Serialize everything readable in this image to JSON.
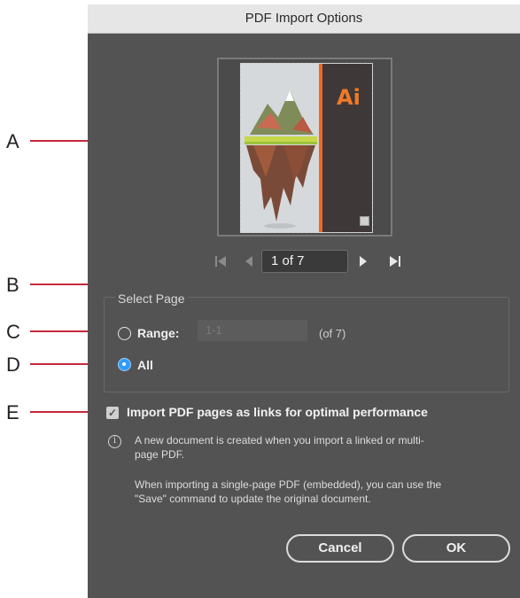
{
  "dialog": {
    "title": "PDF Import Options"
  },
  "preview": {
    "logo_text": "Ai"
  },
  "pagination": {
    "first_icon": "skip-to-first-icon",
    "prev_icon": "previous-icon",
    "next_icon": "next-icon",
    "last_icon": "skip-to-last-icon",
    "page_value": "1 of 7"
  },
  "select_page": {
    "title": "Select Page",
    "range_label": "Range:",
    "range_placeholder": "1-1",
    "range_total": "(of 7)",
    "all_label": "All",
    "selected": "All"
  },
  "import_links": {
    "label": "Import PDF pages as links for optimal performance",
    "checked": true
  },
  "info": {
    "line1": "A new document is created when you import a linked or multi-",
    "line2": "page PDF.",
    "line3": "When importing a single-page PDF (embedded), you can use the",
    "line4": "\"Save\" command to update the original document."
  },
  "buttons": {
    "cancel": "Cancel",
    "ok": "OK"
  },
  "callouts": {
    "a": "A",
    "b": "B",
    "c": "C",
    "d": "D",
    "e": "E"
  },
  "colors": {
    "dialog_bg": "#535353",
    "callout_line": "#c6283a",
    "radio_selected": "#2f9bff",
    "brand_orange": "#ee6a22"
  }
}
